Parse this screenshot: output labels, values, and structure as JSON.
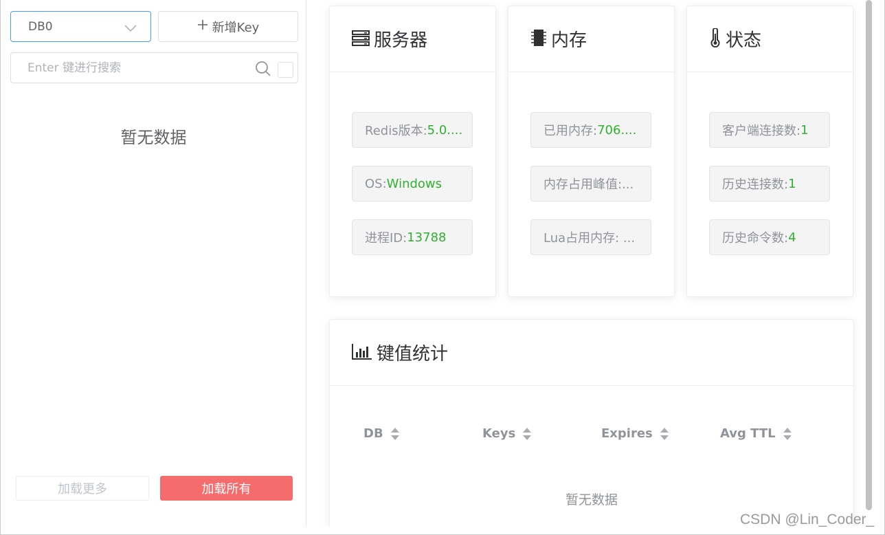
{
  "left_panel": {
    "db_select_value": "DB0",
    "add_key_label": "新增Key",
    "search_placeholder": "Enter 键进行搜索",
    "empty_text": "暂无数据",
    "load_more_label": "加载更多",
    "load_all_label": "加载所有"
  },
  "server_card": {
    "title": "服务器",
    "items": [
      {
        "label": "Redis版本: ",
        "value": "5.0...."
      },
      {
        "label": "OS: ",
        "value": "Windows"
      },
      {
        "label": "进程ID: ",
        "value": "13788"
      }
    ]
  },
  "memory_card": {
    "title": "内存",
    "items": [
      {
        "label": "已用内存: ",
        "value": "706...."
      },
      {
        "label": "内存占用峰值:...",
        "value": ""
      },
      {
        "label": "Lua占用内存: ...",
        "value": ""
      }
    ]
  },
  "status_card": {
    "title": "状态",
    "items": [
      {
        "label": "客户端连接数: ",
        "value": "1"
      },
      {
        "label": "历史连接数: ",
        "value": "1"
      },
      {
        "label": "历史命令数: ",
        "value": "4"
      }
    ]
  },
  "key_stats": {
    "title": "键值统计",
    "columns": [
      "DB",
      "Keys",
      "Expires",
      "Avg TTL"
    ],
    "empty_text": "暂无数据"
  },
  "watermark": "CSDN @Lin_Coder_",
  "colors": {
    "accent": "#409eff",
    "danger": "#f56c6c",
    "value_green": "#2fb12f"
  },
  "icons": {
    "server": "server-icon",
    "memory": "memory-chip-icon",
    "status": "thermometer-icon",
    "stats": "bar-chart-icon"
  }
}
